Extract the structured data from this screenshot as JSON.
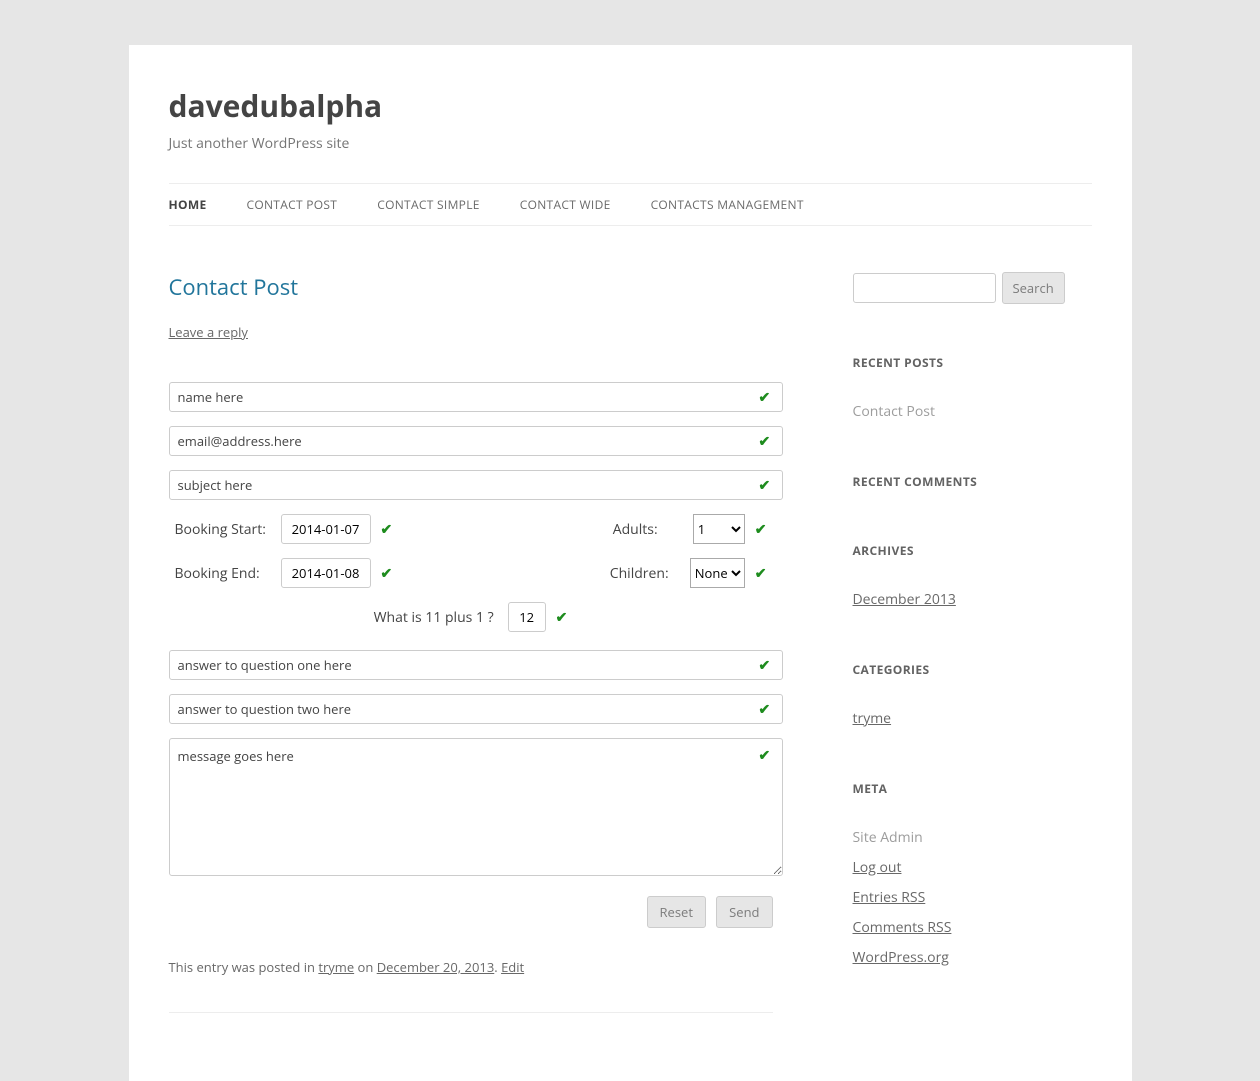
{
  "site": {
    "title": "davedubalpha",
    "description": "Just another WordPress site"
  },
  "nav": {
    "items": [
      {
        "label": "HOME",
        "active": true
      },
      {
        "label": "CONTACT POST",
        "active": false
      },
      {
        "label": "CONTACT SIMPLE",
        "active": false
      },
      {
        "label": "CONTACT WIDE",
        "active": false
      },
      {
        "label": "CONTACTS MANAGEMENT",
        "active": false
      }
    ]
  },
  "post": {
    "title": "Contact Post",
    "leave_reply": "Leave a reply",
    "meta_prefix": "This entry was posted in ",
    "meta_category": "tryme",
    "meta_on": " on ",
    "meta_date": "December 20, 2013",
    "meta_sep": ". ",
    "meta_edit": "Edit"
  },
  "form": {
    "name_value": "name here",
    "email_value": "email@address.here",
    "subject_value": "subject here",
    "booking_start_label": "Booking Start:",
    "booking_start_value": "2014-01-07",
    "booking_end_label": "Booking End:",
    "booking_end_value": "2014-01-08",
    "adults_label": "Adults:",
    "adults_value": "1",
    "children_label": "Children:",
    "children_value": "None",
    "captcha_question": "What is 11 plus 1 ?",
    "captcha_value": "12",
    "q1_value": "answer to question one here",
    "q2_value": "answer to question two here",
    "message_value": "message goes here",
    "reset_label": "Reset",
    "send_label": "Send",
    "check_mark": "✔"
  },
  "sidebar": {
    "search_label": "Search",
    "recent_posts_title": "RECENT POSTS",
    "recent_posts": [
      "Contact Post"
    ],
    "recent_comments_title": "RECENT COMMENTS",
    "archives_title": "ARCHIVES",
    "archives": [
      "December 2013"
    ],
    "categories_title": "CATEGORIES",
    "categories": [
      "tryme"
    ],
    "meta_title": "META",
    "meta_links": [
      "Site Admin",
      "Log out",
      "Entries RSS",
      "Comments RSS",
      "WordPress.org"
    ]
  }
}
